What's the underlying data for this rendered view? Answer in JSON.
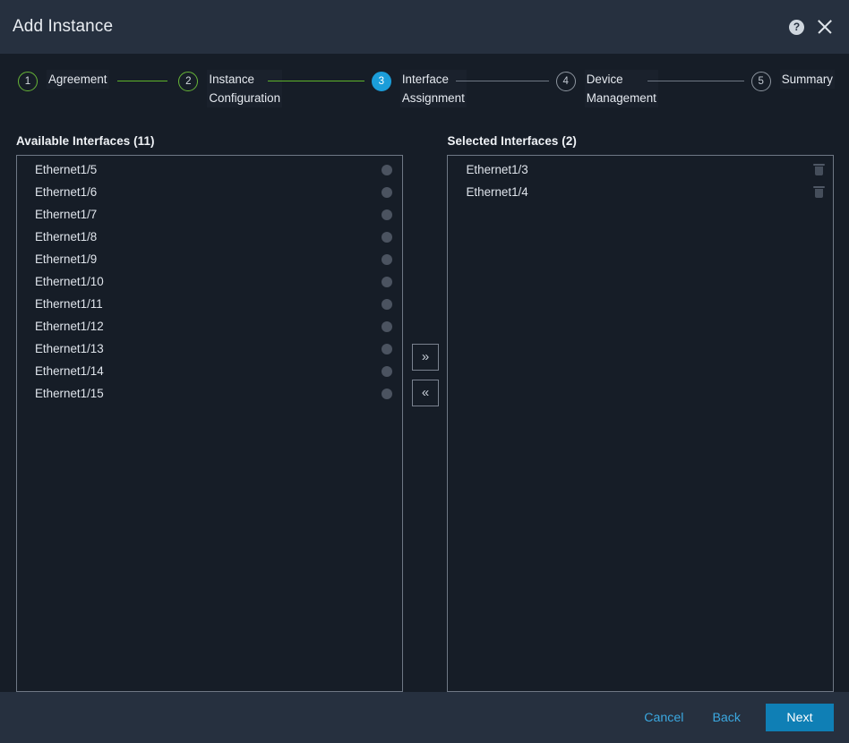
{
  "header": {
    "title": "Add Instance",
    "help_icon": "help-circle-icon",
    "close_icon": "close-icon"
  },
  "stepper": {
    "steps": [
      {
        "number": "1",
        "label": "Agreement",
        "state": "done"
      },
      {
        "number": "2",
        "label": "Instance\nConfiguration",
        "state": "done"
      },
      {
        "number": "3",
        "label": "Interface\nAssignment",
        "state": "active"
      },
      {
        "number": "4",
        "label": "Device\nManagement",
        "state": "todo"
      },
      {
        "number": "5",
        "label": "Summary",
        "state": "todo"
      }
    ],
    "connector_colors": {
      "completed": "#5eb32a",
      "pending": "#6f7884"
    }
  },
  "available_panel": {
    "title": "Available Interfaces (11)",
    "count": 11,
    "items": [
      {
        "name": "Ethernet1/5"
      },
      {
        "name": "Ethernet1/6"
      },
      {
        "name": "Ethernet1/7"
      },
      {
        "name": "Ethernet1/8"
      },
      {
        "name": "Ethernet1/9"
      },
      {
        "name": "Ethernet1/10"
      },
      {
        "name": "Ethernet1/11"
      },
      {
        "name": "Ethernet1/12"
      },
      {
        "name": "Ethernet1/13"
      },
      {
        "name": "Ethernet1/14"
      },
      {
        "name": "Ethernet1/15"
      }
    ]
  },
  "selected_panel": {
    "title": "Selected Interfaces (2)",
    "count": 2,
    "items": [
      {
        "name": "Ethernet1/3"
      },
      {
        "name": "Ethernet1/4"
      }
    ]
  },
  "transfer": {
    "move_right_label": "»",
    "move_left_label": "«"
  },
  "footer": {
    "cancel_label": "Cancel",
    "back_label": "Back",
    "next_label": "Next"
  },
  "colors": {
    "header_bg": "#26303f",
    "body_bg": "#161d27",
    "accent_blue": "#1b9dd9",
    "primary_button": "#0f7fb5",
    "link_blue": "#3ba8e0",
    "step_done_green": "#67b637",
    "dot_grey": "#4b5360",
    "panel_border": "#6f7885"
  }
}
